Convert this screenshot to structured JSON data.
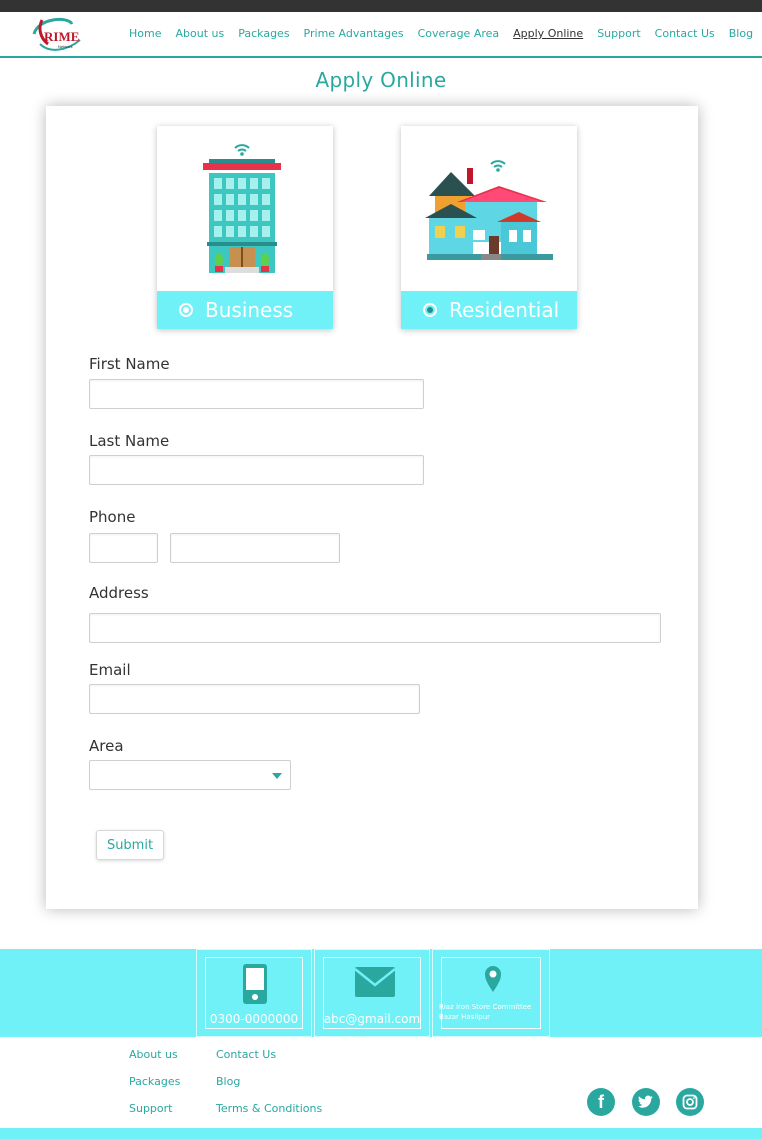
{
  "logo": {
    "text": "RIME",
    "subtext": "Network"
  },
  "nav": {
    "items": [
      {
        "label": "Home"
      },
      {
        "label": "About us"
      },
      {
        "label": "Packages"
      },
      {
        "label": "Prime Advantages"
      },
      {
        "label": "Coverage Area"
      },
      {
        "label": "Apply Online",
        "active": true
      },
      {
        "label": "Support"
      },
      {
        "label": "Contact Us"
      },
      {
        "label": "Blog"
      }
    ]
  },
  "page": {
    "title": "Apply Online"
  },
  "connection_types": [
    {
      "label": "Business",
      "icon": "office-building-icon",
      "selected": false
    },
    {
      "label": "Residential",
      "icon": "house-icon",
      "selected": true
    }
  ],
  "form": {
    "first_name": {
      "label": "First Name",
      "value": ""
    },
    "last_name": {
      "label": "Last Name",
      "value": ""
    },
    "phone": {
      "label": "Phone",
      "code": "",
      "number": ""
    },
    "address": {
      "label": "Address",
      "value": ""
    },
    "email": {
      "label": "Email",
      "value": ""
    },
    "area": {
      "label": "Area",
      "value": ""
    },
    "submit_label": "Submit"
  },
  "contact": {
    "phone": "0300-0000000",
    "email": "abc@gmail.com",
    "address": "Riaz Iron Store Committee Bazar Hasilpur"
  },
  "footer": {
    "col1": [
      "About us",
      "Packages",
      "Support"
    ],
    "col2": [
      "Contact Us",
      "Blog",
      "Terms & Conditions"
    ],
    "social": [
      "facebook-icon",
      "twitter-icon",
      "instagram-icon"
    ]
  },
  "colors": {
    "accent": "#2aa8a0",
    "cyan": "#6ff1f7",
    "topbar": "#333333"
  }
}
